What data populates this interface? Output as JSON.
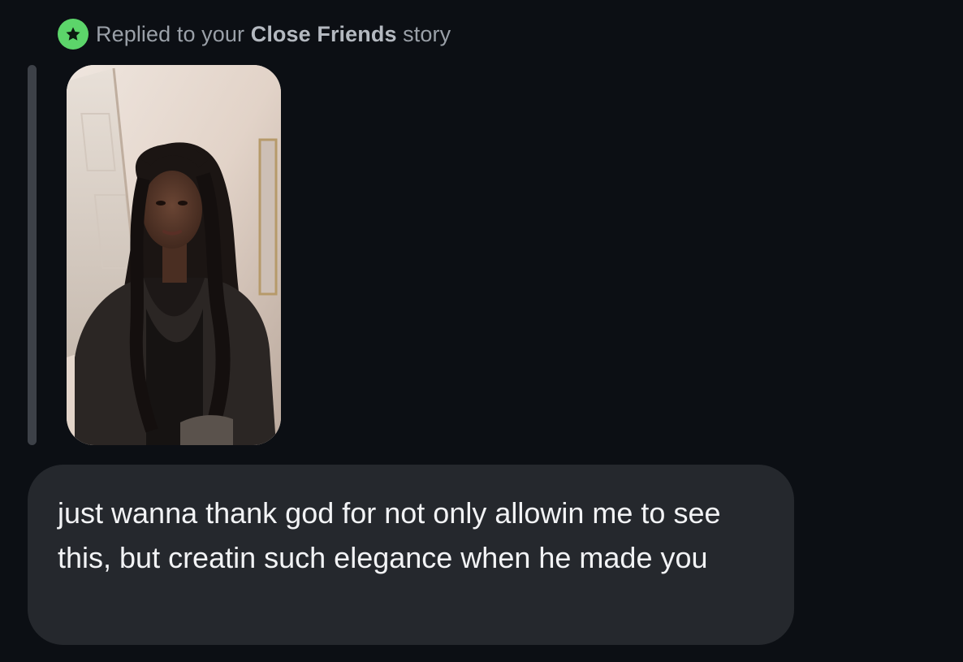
{
  "reply_header": {
    "prefix": "Replied to your ",
    "highlight": "Close Friends",
    "suffix": " story",
    "badge_icon": "star-icon",
    "badge_color": "#5cd56a"
  },
  "story_preview": {
    "kind": "photo"
  },
  "message": {
    "text": "just wanna thank god for not only allowin me to see this, but creatin such elegance when he made you"
  },
  "colors": {
    "background": "#0c0f14",
    "bubble": "#25282d",
    "message_text": "#f2f3f5",
    "header_text": "#9aa0a8",
    "quote_bar": "#3d4148"
  }
}
